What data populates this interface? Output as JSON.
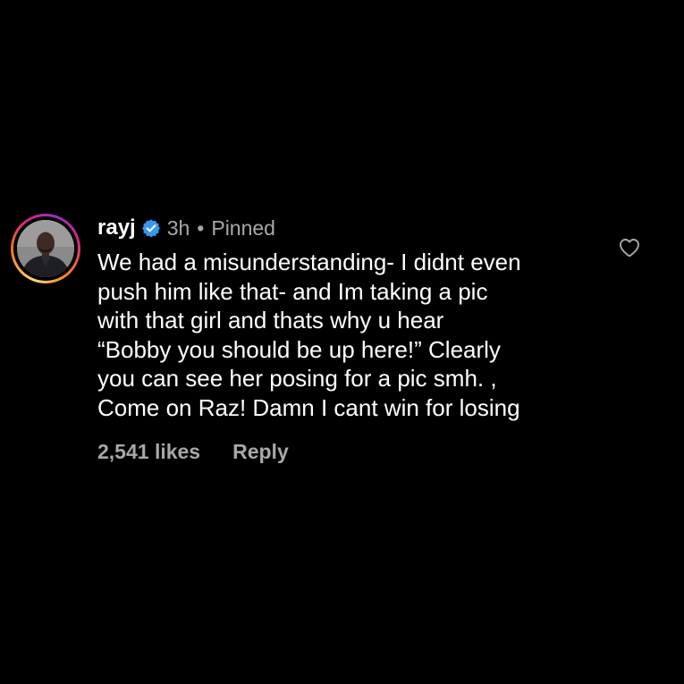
{
  "comment": {
    "username": "rayj",
    "verified_icon": "verified-badge-icon",
    "time": "3h",
    "separator": "•",
    "pinned_label": "Pinned",
    "text_lines": [
      "We had a misunderstanding- I didnt even",
      "push him like that- and Im taking a pic",
      "with that girl and thats why u hear",
      "“Bobby you should be up here!” Clearly",
      "you can see her posing for a pic smh. ,",
      "Come on Raz! Damn I cant win for losing"
    ],
    "likes": "2,541 likes",
    "reply_label": "Reply",
    "like_icon": "heart-outline-icon"
  },
  "colors": {
    "background": "#000000",
    "primary_text": "#ffffff",
    "secondary_text": "#a8a8a8",
    "verified_blue": "#3897f0"
  }
}
